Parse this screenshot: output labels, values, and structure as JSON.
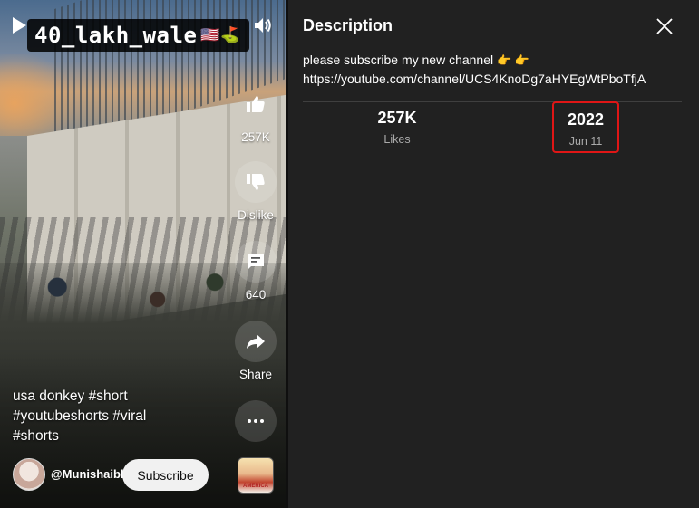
{
  "video": {
    "overlay_title": "40_lakh_wale",
    "overlay_flags": "🇺🇸⛳",
    "actions": {
      "like_count": "257K",
      "dislike_label": "Dislike",
      "comment_count": "640",
      "share_label": "Share"
    },
    "caption_lines": [
      "usa donkey #short",
      "#youtubeshorts #viral",
      "#shorts"
    ],
    "channel_handle": "@Munishaibli_ROR",
    "subscribe_label": "Subscribe",
    "sound_thumb_text": "AMERICA"
  },
  "panel": {
    "title": "Description",
    "description_line1": "please subscribe my new channel",
    "description_emojis": "👉 👉",
    "description_link": "https://youtube.com/channel/UCS4KnoDg7aHYEgWtPboTfjA",
    "stats": {
      "likes_value": "257K",
      "likes_label": "Likes",
      "year": "2022",
      "date": "Jun 11"
    }
  },
  "colors": {
    "panel_bg": "#212121",
    "highlight_border": "#e01616",
    "subscribe_bg": "#f1f1f1"
  }
}
